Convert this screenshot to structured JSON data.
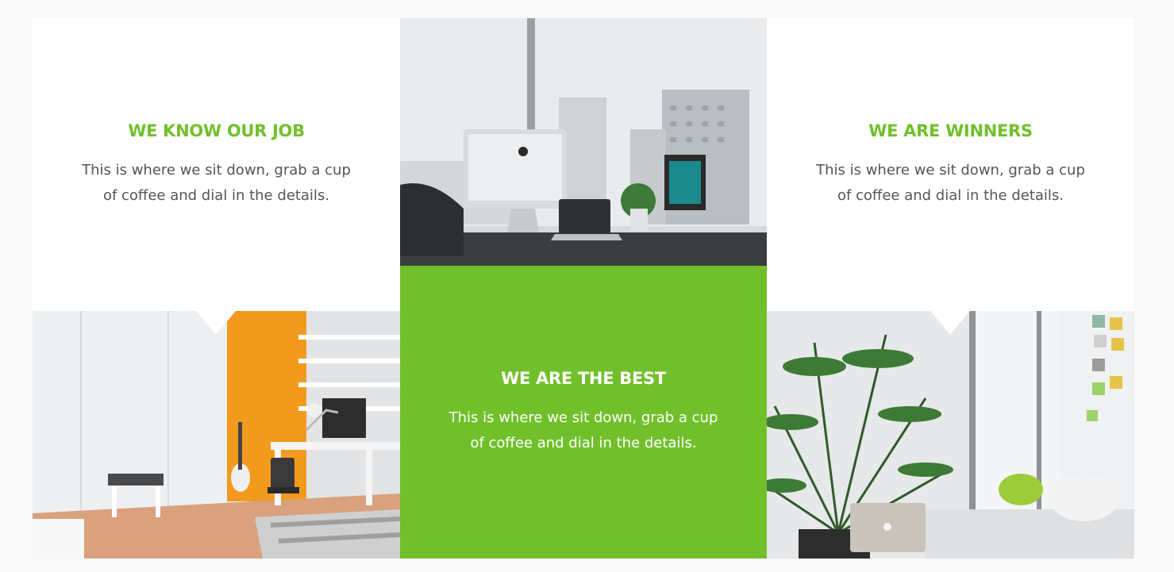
{
  "features": [
    {
      "title": "WE KNOW OUR JOB",
      "text": "This is where we sit down, grab a cup of coffee and dial in the details."
    },
    {
      "title": "WE ARE THE BEST",
      "text": "This is where we sit down, grab a cup of coffee and dial in the details."
    },
    {
      "title": "WE ARE WINNERS",
      "text": "This is where we sit down, grab a cup of coffee and dial in the details."
    }
  ],
  "images": [
    {
      "icon": "office-desk-photo"
    },
    {
      "icon": "bedroom-desk-photo"
    },
    {
      "icon": "lounge-plant-photo"
    }
  ],
  "colors": {
    "accent": "#71c02b",
    "text": "#555555",
    "background": "#f9f9f9"
  }
}
